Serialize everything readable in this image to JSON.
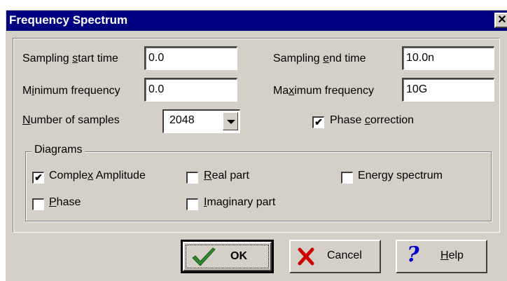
{
  "window": {
    "title": "Frequency Spectrum",
    "close_glyph": "✕"
  },
  "fields": {
    "sampling_start": {
      "label_pre": "Sampling ",
      "label_u": "s",
      "label_post": "tart time",
      "value": "0.0"
    },
    "sampling_end": {
      "label_pre": "Sampling ",
      "label_u": "e",
      "label_post": "nd time",
      "value": "10.0n"
    },
    "min_freq": {
      "label_pre": "M",
      "label_u": "i",
      "label_post": "nimum frequency",
      "value": "0.0"
    },
    "max_freq": {
      "label_pre": "Ma",
      "label_u": "x",
      "label_post": "imum frequency",
      "value": "10G"
    },
    "num_samples": {
      "label_pre": "",
      "label_u": "N",
      "label_post": "umber of samples",
      "value": "2048"
    }
  },
  "phase_correction": {
    "label_pre": "Phase ",
    "label_u": "c",
    "label_post": "orrection",
    "checked": true
  },
  "diagrams": {
    "title": "Diagrams",
    "complex_amplitude": {
      "label_pre": "Comple",
      "label_u": "x",
      "label_post": " Amplitude",
      "checked": true
    },
    "real_part": {
      "label_pre": "",
      "label_u": "R",
      "label_post": "eal part",
      "checked": false
    },
    "energy_spectrum": {
      "label_pre": "Ener",
      "label_u": "g",
      "label_post": "y spectrum",
      "checked": false
    },
    "phase": {
      "label_pre": "",
      "label_u": "P",
      "label_post": "hase",
      "checked": false
    },
    "imaginary_part": {
      "label_pre": "",
      "label_u": "I",
      "label_post": "maginary part",
      "checked": false
    }
  },
  "buttons": {
    "ok": "OK",
    "cancel": "Cancel",
    "help_u": "H",
    "help_post": "elp"
  },
  "icons": {
    "ok": "checkmark-icon",
    "cancel": "x-icon",
    "help": "question-icon",
    "colors": {
      "check": "#2e8b2e",
      "cancel": "#cc0000",
      "help": "#0000cc"
    }
  }
}
